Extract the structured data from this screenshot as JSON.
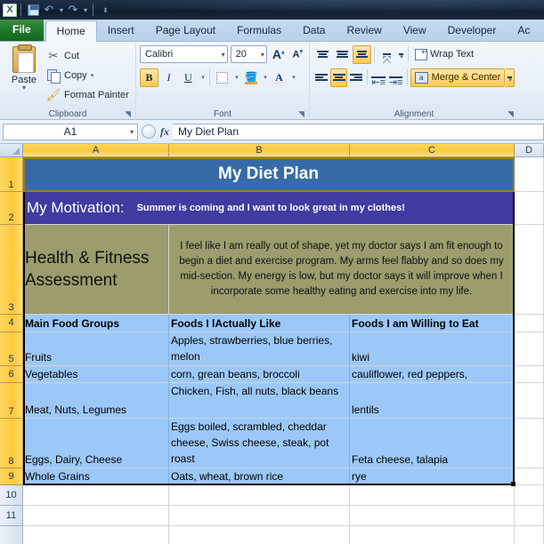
{
  "titlebar": {
    "app_icon": "excel-logo-icon",
    "quick_access": [
      {
        "name": "save-icon",
        "label": "Save"
      },
      {
        "name": "undo-icon",
        "label": "Undo"
      },
      {
        "name": "redo-icon",
        "label": "Redo"
      },
      {
        "name": "customize-qat-icon",
        "label": "Customize Quick Access Toolbar"
      }
    ]
  },
  "ribbon": {
    "tabs": [
      {
        "label": "File",
        "active": false
      },
      {
        "label": "Home",
        "active": true
      },
      {
        "label": "Insert",
        "active": false
      },
      {
        "label": "Page Layout",
        "active": false
      },
      {
        "label": "Formulas",
        "active": false
      },
      {
        "label": "Data",
        "active": false
      },
      {
        "label": "Review",
        "active": false
      },
      {
        "label": "View",
        "active": false
      },
      {
        "label": "Developer",
        "active": false
      },
      {
        "label": "Ac",
        "active": false
      }
    ],
    "clipboard": {
      "group_label": "Clipboard",
      "paste_label": "Paste",
      "cut_label": "Cut",
      "copy_label": "Copy",
      "format_painter_label": "Format Painter"
    },
    "font": {
      "group_label": "Font",
      "font_name": "Calibri",
      "font_size": "20",
      "grow_font_label": "A",
      "shrink_font_label": "A",
      "bold_label": "B",
      "italic_label": "I",
      "underline_label": "U",
      "borders_label": "Borders",
      "fill_color_label": "Fill Color",
      "font_color_label": "A"
    },
    "alignment": {
      "group_label": "Alignment",
      "top_align_label": "Top Align",
      "middle_align_label": "Middle Align",
      "bottom_align_label": "Bottom Align",
      "orientation_label": "Orientation",
      "align_left_label": "Align Text Left",
      "align_center_label": "Center",
      "align_right_label": "Align Text Right",
      "decrease_indent_label": "Decrease Indent",
      "increase_indent_label": "Increase Indent",
      "wrap_text_label": "Wrap Text",
      "merge_center_label": "Merge & Center"
    }
  },
  "formula_bar": {
    "name_box": "A1",
    "formula_value": "My Diet Plan",
    "fx_label": "fx"
  },
  "sheet": {
    "column_headers": [
      "A",
      "B",
      "C",
      "D"
    ],
    "row_headers": [
      "1",
      "2",
      "3",
      "4",
      "5",
      "6",
      "7",
      "8",
      "9",
      "10",
      "11"
    ],
    "title": "My Diet Plan",
    "motivation_label": "My Motivation:",
    "motivation_text": "Summer is coming and I want to look great in my clothes!",
    "assessment_label": "Health & Fitness Assessment",
    "assessment_text": "I feel like I am really out of shape, yet my doctor says I am fit enough to begin a diet and exercise program. My arms feel flabby and so does my mid-section. My energy is low, but my doctor says it will improve when I incorporate some healthy eating and exercise into my life.",
    "table_headers": [
      "Main Food Groups",
      "Foods I lActually Like",
      "Foods I am Willing to Eat"
    ],
    "table_rows": [
      {
        "group": "Fruits",
        "like": "Apples, strawberries, blue berries, melon",
        "willing": "kiwi"
      },
      {
        "group": "Vegetables",
        "like": "corn, grean beans, broccoli",
        "willing": "cauliflower, red peppers,"
      },
      {
        "group": "Meat, Nuts, Legumes",
        "like": "Chicken, Fish, all nuts, black beans",
        "willing": "lentils"
      },
      {
        "group": "Eggs, Dairy, Cheese",
        "like": "Eggs boiled, scrambled, cheddar cheese, Swiss cheese, steak, pot roast",
        "willing": "Feta cheese, talapia"
      },
      {
        "group": "Whole Grains",
        "like": "Oats, wheat, brown rice",
        "willing": "rye"
      }
    ]
  },
  "colors": {
    "title_fill": "#366ba8",
    "motivation_fill": "#403ca0",
    "assessment_fill": "#9c9c6e",
    "table_fill": "#9cc8f8",
    "header_selected": "#ffc83c",
    "file_tab": "#1e7a2c"
  }
}
